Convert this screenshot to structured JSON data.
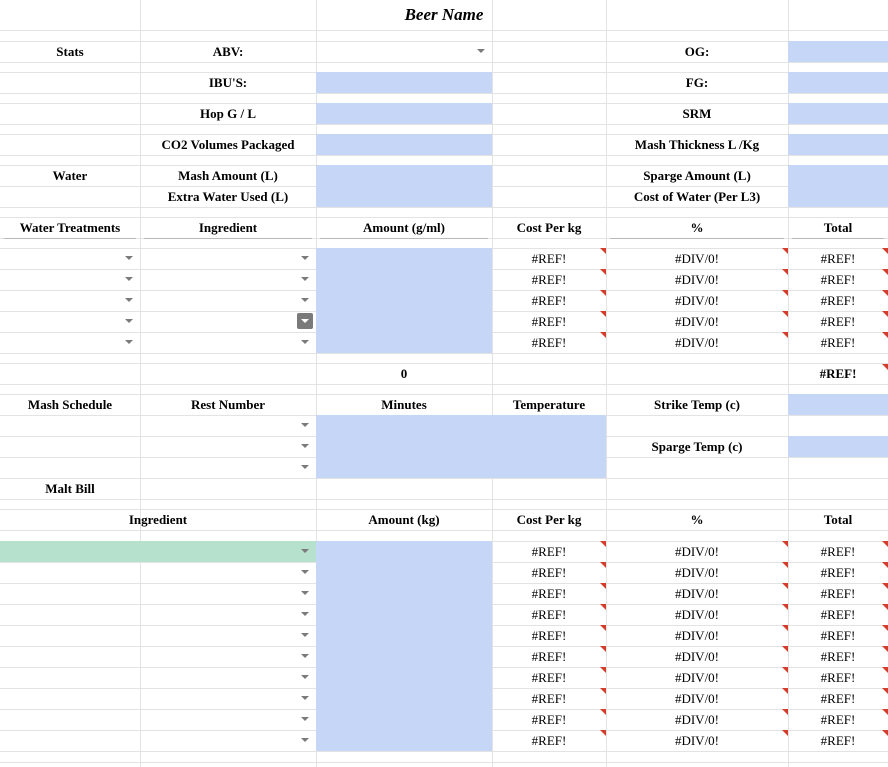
{
  "title": "Beer Name",
  "stats": {
    "section": "Stats",
    "abv": "ABV:",
    "ibu": "IBU'S:",
    "hop": "Hop G / L",
    "co2": "CO2 Volumes Packaged",
    "og": "OG:",
    "fg": "FG:",
    "srm": "SRM",
    "mash_thickness": "Mash Thickness L /Kg"
  },
  "water": {
    "section": "Water",
    "mash_amount": "Mash Amount (L)",
    "extra_water": "Extra Water Used (L)",
    "sparge_amount": "Sparge Amount (L)",
    "cost_of_water": "Cost of Water (Per L3)"
  },
  "treatments": {
    "headers": [
      "Water Treatments",
      "Ingredient",
      "Amount (g/ml)",
      "Cost Per kg",
      "%",
      "Total"
    ],
    "rows": [
      {
        "cost": "#REF!",
        "pct": "#DIV/0!",
        "total": "#REF!"
      },
      {
        "cost": "#REF!",
        "pct": "#DIV/0!",
        "total": "#REF!"
      },
      {
        "cost": "#REF!",
        "pct": "#DIV/0!",
        "total": "#REF!"
      },
      {
        "cost": "#REF!",
        "pct": "#DIV/0!",
        "total": "#REF!"
      },
      {
        "cost": "#REF!",
        "pct": "#DIV/0!",
        "total": "#REF!"
      }
    ],
    "sum_amount": "0",
    "sum_total": "#REF!"
  },
  "mash": {
    "headers": [
      "Mash Schedule",
      "Rest Number",
      "Minutes",
      "Temperature"
    ],
    "strike_temp": "Strike Temp (c)",
    "sparge_temp": "Sparge Temp (c)"
  },
  "malt": {
    "section": "Malt Bill",
    "headers": [
      "Ingredient",
      "Amount (kg)",
      "Cost Per kg",
      "%",
      "Total"
    ],
    "rows": [
      {
        "cost": "#REF!",
        "pct": "#DIV/0!",
        "total": "#REF!"
      },
      {
        "cost": "#REF!",
        "pct": "#DIV/0!",
        "total": "#REF!"
      },
      {
        "cost": "#REF!",
        "pct": "#DIV/0!",
        "total": "#REF!"
      },
      {
        "cost": "#REF!",
        "pct": "#DIV/0!",
        "total": "#REF!"
      },
      {
        "cost": "#REF!",
        "pct": "#DIV/0!",
        "total": "#REF!"
      },
      {
        "cost": "#REF!",
        "pct": "#DIV/0!",
        "total": "#REF!"
      },
      {
        "cost": "#REF!",
        "pct": "#DIV/0!",
        "total": "#REF!"
      },
      {
        "cost": "#REF!",
        "pct": "#DIV/0!",
        "total": "#REF!"
      },
      {
        "cost": "#REF!",
        "pct": "#DIV/0!",
        "total": "#REF!"
      },
      {
        "cost": "#REF!",
        "pct": "#DIV/0!",
        "total": "#REF!"
      }
    ]
  },
  "colors": {
    "input_fill": "#c6d6f7",
    "selected_fill": "#b6e1cc",
    "error_marker": "#d43d2a",
    "gridline": "#e3e3e3"
  },
  "icons": {
    "dropdown": "chevron-down-icon",
    "error": "error-triangle-icon"
  }
}
